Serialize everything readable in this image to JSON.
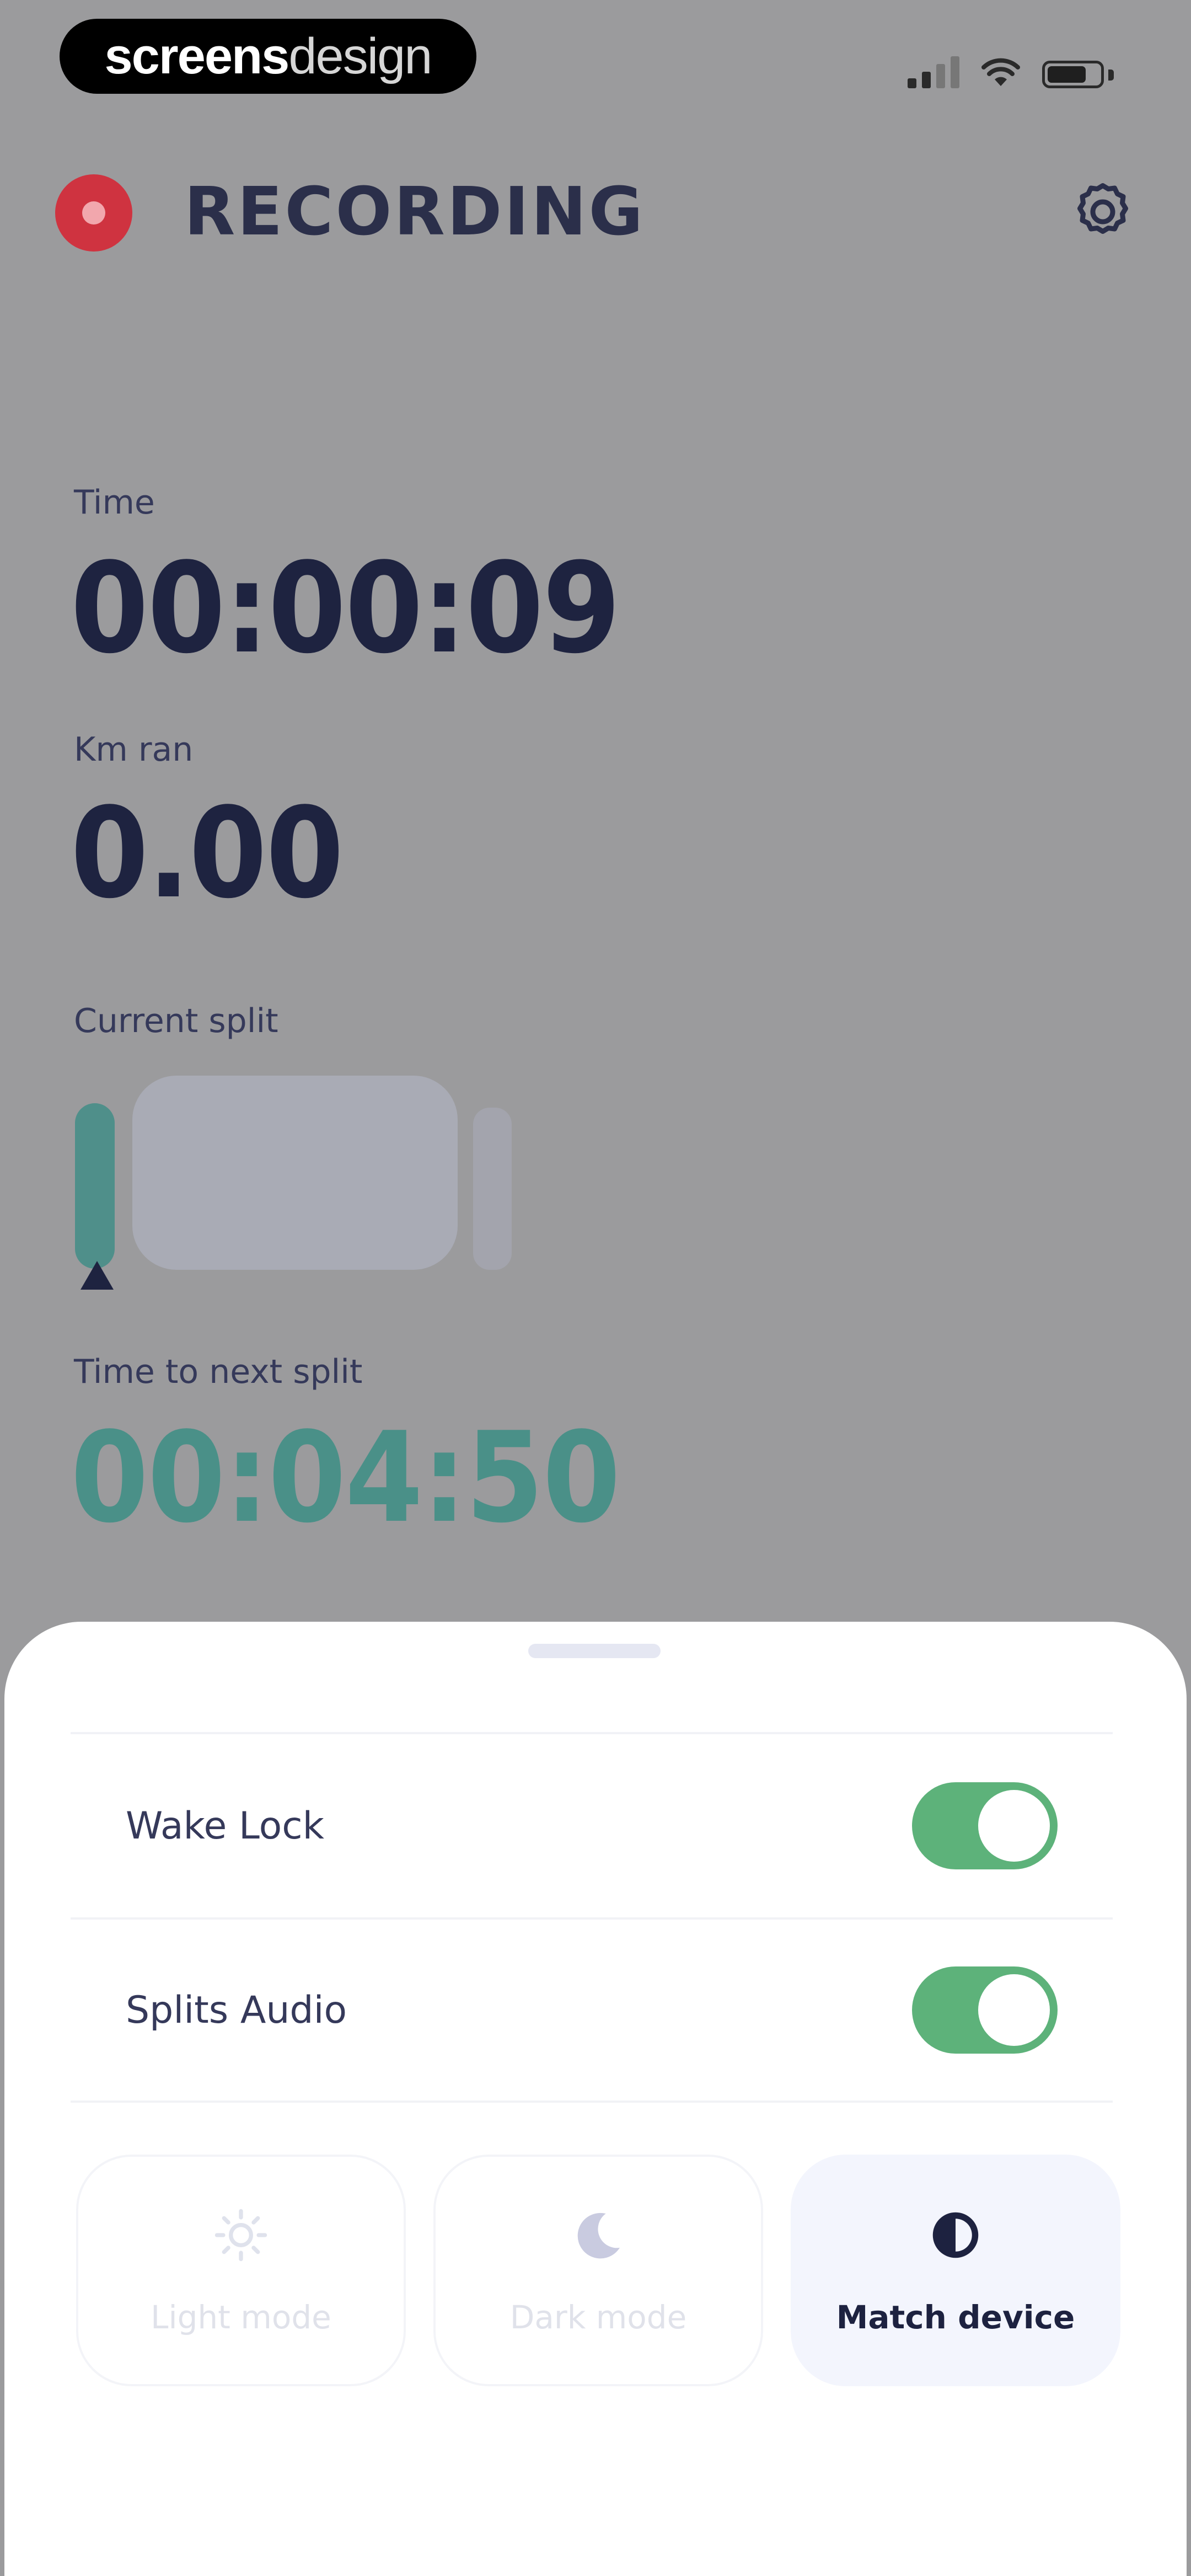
{
  "status_bar": {
    "watermark_part1": "screens",
    "watermark_part2": "design",
    "icons": [
      "signal-icon",
      "wifi-icon",
      "battery-icon"
    ]
  },
  "header": {
    "title": "RECORDING",
    "record_icon": "record-icon",
    "settings_icon": "gear-icon"
  },
  "metrics": {
    "time_label": "Time",
    "time_value": "00:00:09",
    "distance_label": "Km ran",
    "distance_value": "0.00",
    "split_label": "Current split",
    "next_split_label": "Time to next split",
    "next_split_value": "00:04:50"
  },
  "sheet": {
    "settings": [
      {
        "label": "Wake Lock",
        "enabled": true
      },
      {
        "label": "Splits Audio",
        "enabled": true
      }
    ],
    "modes": [
      {
        "label": "Light mode",
        "icon": "sun-icon",
        "selected": false
      },
      {
        "label": "Dark mode",
        "icon": "moon-icon",
        "selected": false
      },
      {
        "label": "Match device",
        "icon": "half-circle-icon",
        "selected": true
      }
    ]
  },
  "colors": {
    "record_red": "#cf3340",
    "toggle_green": "#5db27a",
    "teal_accent": "#4a9088",
    "overlay_gray": "#9b9b9d"
  }
}
